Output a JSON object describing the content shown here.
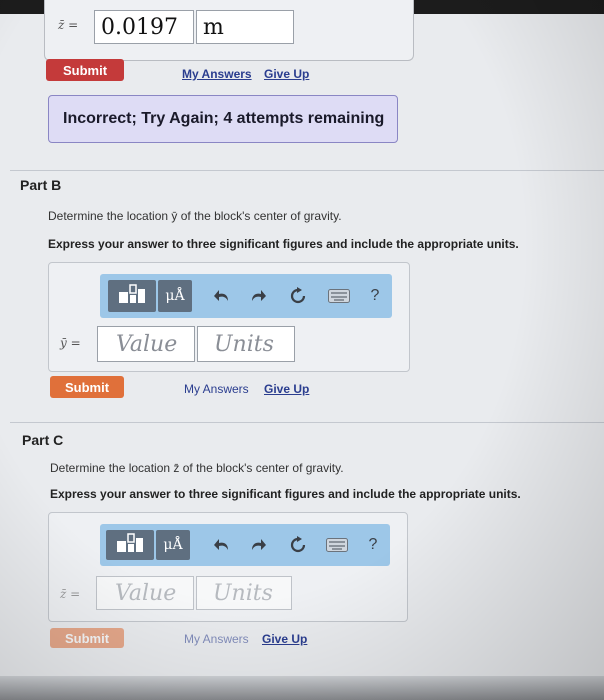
{
  "partA": {
    "var_symbol": "z̄ =",
    "answer_value": "0.0197",
    "answer_units": "m",
    "submit_label": "Submit",
    "my_answers_label": "My Answers",
    "give_up_label": "Give Up",
    "feedback_text": "Incorrect; Try Again; 4 attempts remaining"
  },
  "partB": {
    "title": "Part B",
    "question": "Determine the location ȳ of the block's center of gravity.",
    "instruction": "Express your answer to three significant figures and include the appropriate units.",
    "var_symbol": "ȳ =",
    "value_placeholder": "Value",
    "units_placeholder": "Units",
    "mu_label": "μÅ",
    "help_label": "?",
    "submit_label": "Submit",
    "my_answers_label": "My Answers",
    "give_up_label": "Give Up"
  },
  "partC": {
    "title": "Part C",
    "question": "Determine the location z̄ of the block's center of gravity.",
    "instruction": "Express your answer to three significant figures and include the appropriate units.",
    "var_symbol": "z̄ =",
    "value_placeholder": "Value",
    "units_placeholder": "Units",
    "mu_label": "μÅ",
    "help_label": "?",
    "submit_label": "Submit",
    "my_answers_label": "My Answers",
    "give_up_label": "Give Up"
  },
  "icons": [
    "templates-icon",
    "undo-icon",
    "redo-icon",
    "reset-icon",
    "keyboard-icon",
    "help-icon"
  ],
  "colors": {
    "submit_active": "#c43a3a",
    "submit_orange": "#e0703a",
    "toolbar_blue": "#9dc7e8",
    "feedback_bg": "#dedcf5",
    "link_blue": "#2a3d8f"
  }
}
